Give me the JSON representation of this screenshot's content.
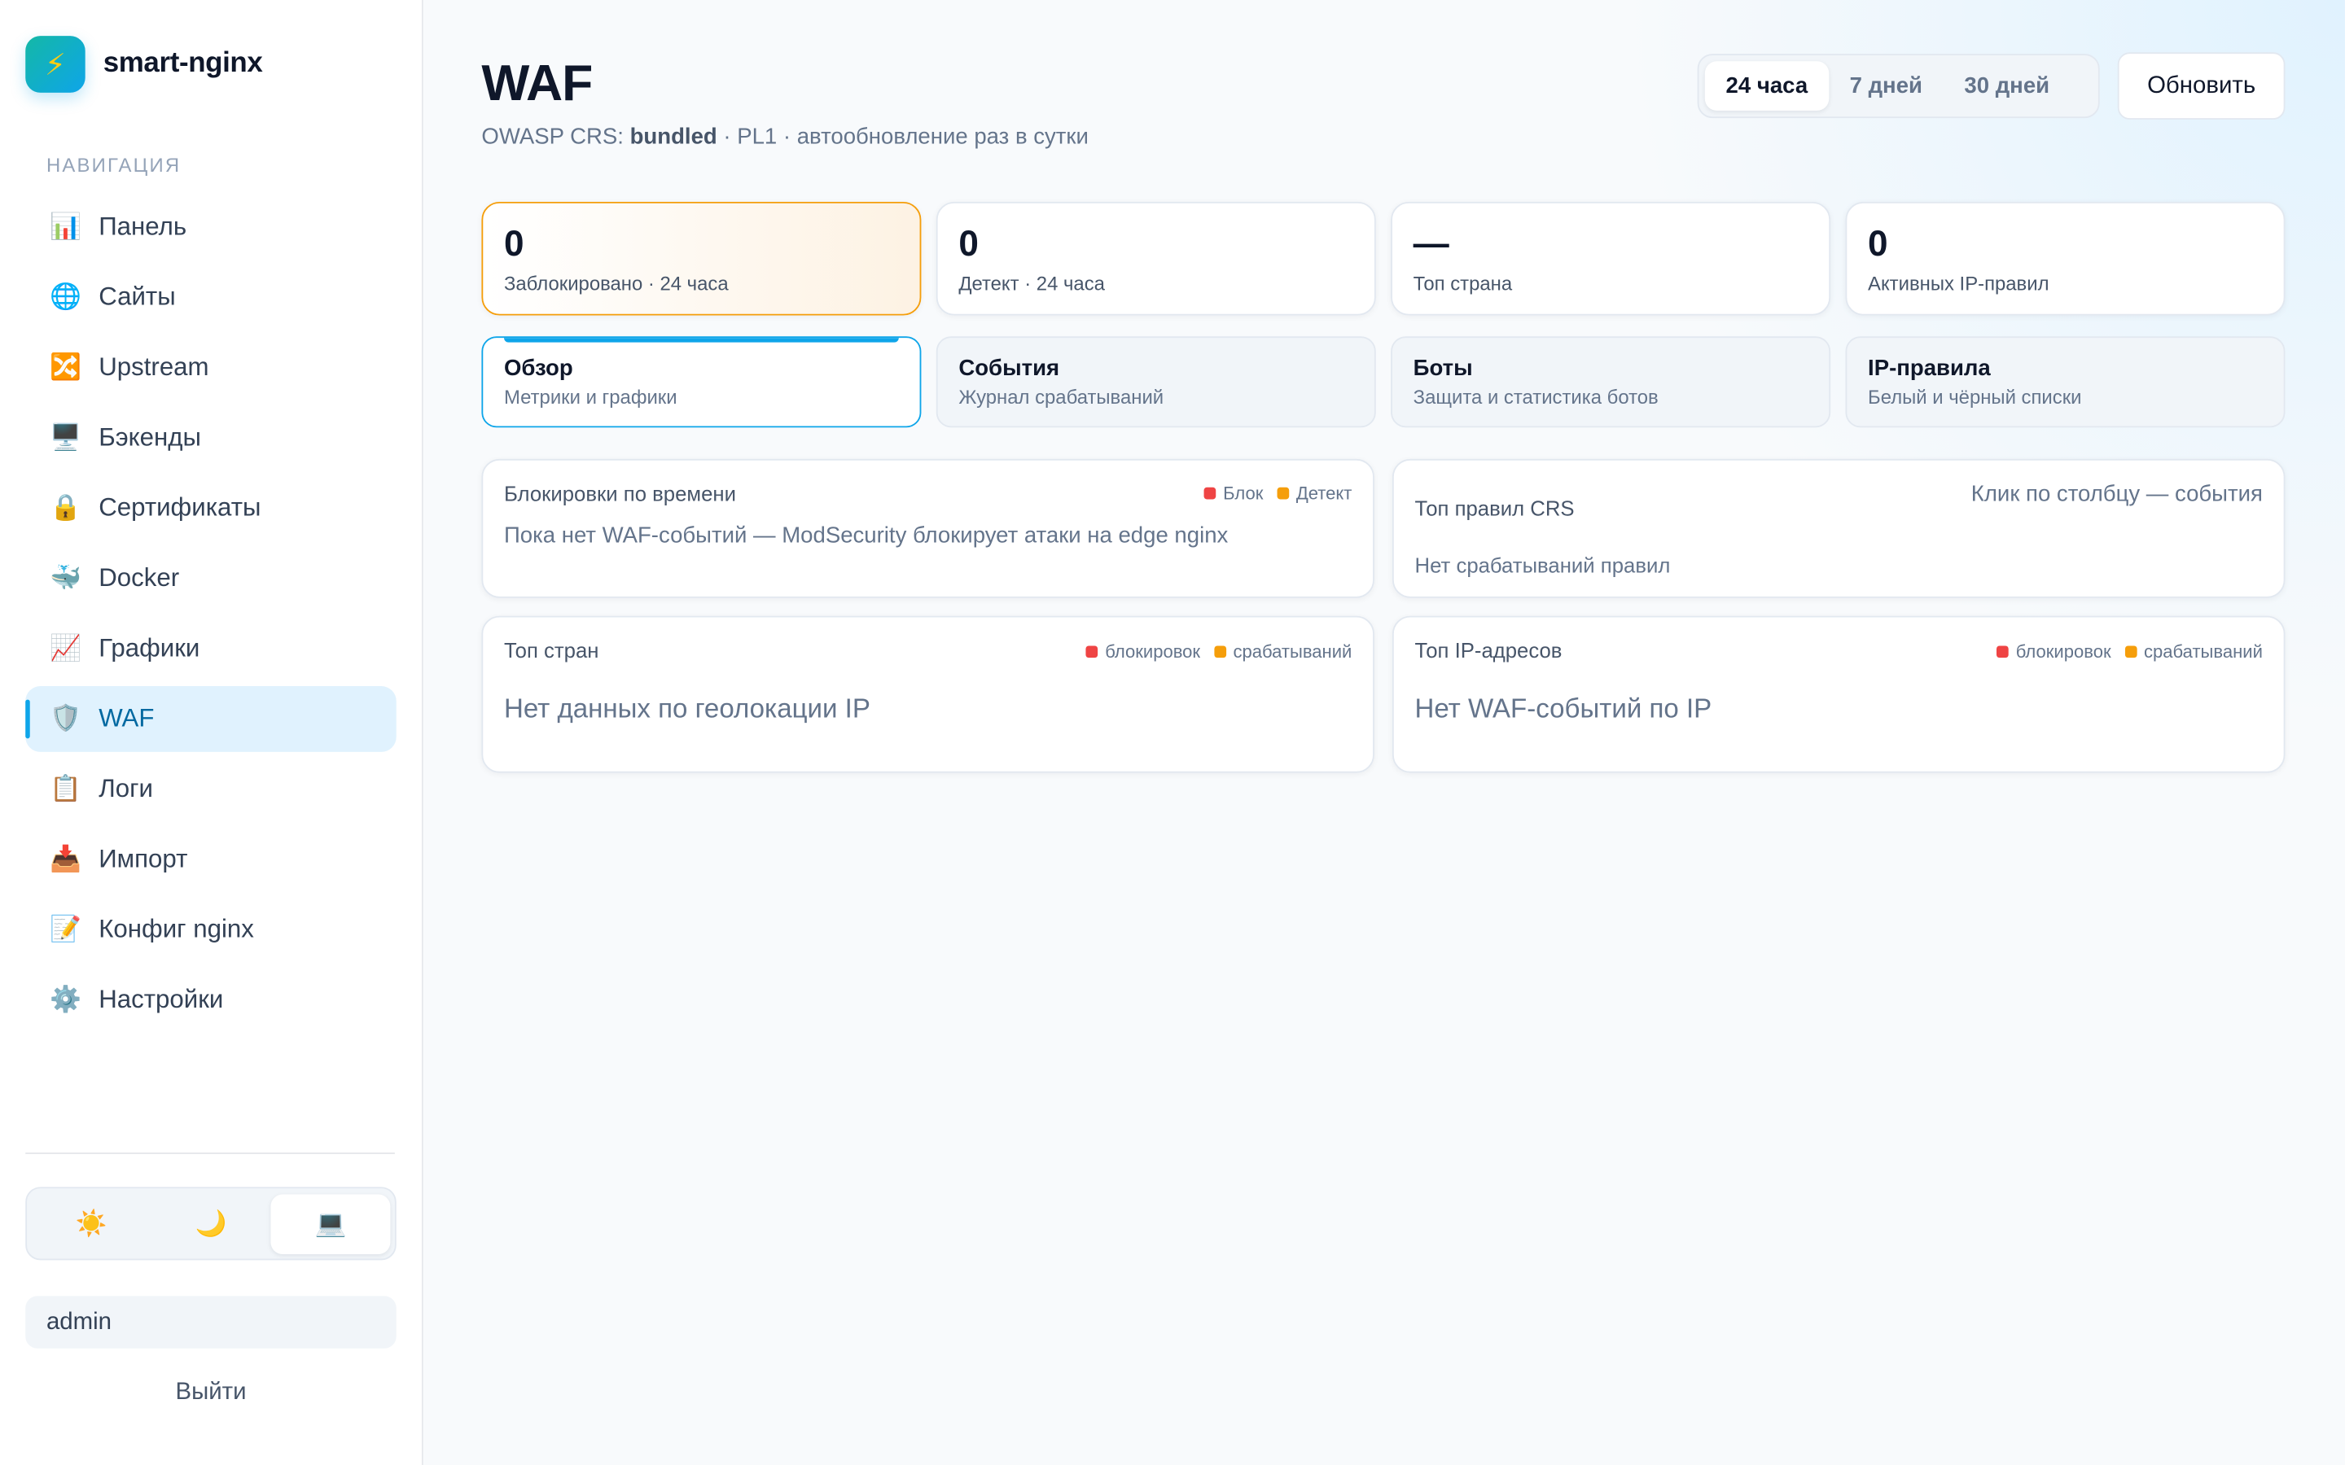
{
  "brand": {
    "name": "smart-nginx",
    "logo_icon": "lightning-icon"
  },
  "nav": {
    "heading": "НАВИГАЦИЯ",
    "items": [
      {
        "label": "Панель",
        "icon": "📊"
      },
      {
        "label": "Сайты",
        "icon": "🌐"
      },
      {
        "label": "Upstream",
        "icon": "🔀"
      },
      {
        "label": "Бэкенды",
        "icon": "🖥️"
      },
      {
        "label": "Сертификаты",
        "icon": "🔒"
      },
      {
        "label": "Docker",
        "icon": "🐳"
      },
      {
        "label": "Графики",
        "icon": "📈"
      },
      {
        "label": "WAF",
        "icon": "🛡️",
        "active": true
      },
      {
        "label": "Логи",
        "icon": "📋"
      },
      {
        "label": "Импорт",
        "icon": "📥"
      },
      {
        "label": "Конфиг nginx",
        "icon": "📝"
      },
      {
        "label": "Настройки",
        "icon": "⚙️"
      }
    ]
  },
  "theme": {
    "light": "☀️",
    "dark": "🌙",
    "system": "💻",
    "selected": "system"
  },
  "user": {
    "name": "admin",
    "logout_label": "Выйти"
  },
  "header": {
    "title": "WAF",
    "subtitle_prefix": "OWASP CRS: ",
    "subtitle_bold": "bundled",
    "subtitle_suffix": " · PL1 · автообновление раз в сутки"
  },
  "range": {
    "options": [
      "24 часа",
      "7 дней",
      "30 дней"
    ],
    "selected": "24 часа"
  },
  "refresh_label": "Обновить",
  "stats": [
    {
      "value": "0",
      "label": "Заблокировано · 24 часа",
      "highlight": true
    },
    {
      "value": "0",
      "label": "Детект · 24 часа"
    },
    {
      "value": "—",
      "label": "Топ страна"
    },
    {
      "value": "0",
      "label": "Активных IP-правил"
    }
  ],
  "tabs": [
    {
      "title": "Обзор",
      "desc": "Метрики и графики",
      "active": true
    },
    {
      "title": "События",
      "desc": "Журнал срабатываний"
    },
    {
      "title": "Боты",
      "desc": "Защита и статистика ботов"
    },
    {
      "title": "IP-правила",
      "desc": "Белый и чёрный списки"
    }
  ],
  "cards": {
    "timeline": {
      "title": "Блокировки по времени",
      "legend_block": "Блок",
      "legend_detect": "Детект",
      "empty": "Пока нет WAF-событий — ModSecurity блокирует атаки на edge nginx"
    },
    "rules": {
      "title": "Топ правил CRS",
      "hint": "Клик по столбцу — события",
      "empty": "Нет срабатываний правил"
    },
    "countries": {
      "title": "Топ стран",
      "legend_block": "блокировок",
      "legend_detect": "срабатываний",
      "empty": "Нет данных по геолокации IP"
    },
    "ips": {
      "title": "Топ IP-адресов",
      "legend_block": "блокировок",
      "legend_detect": "срабатываний",
      "empty": "Нет WAF-событий по IP"
    }
  },
  "colors": {
    "accent": "#0ea5e9",
    "block": "#ef4444",
    "detect": "#f59e0b"
  }
}
